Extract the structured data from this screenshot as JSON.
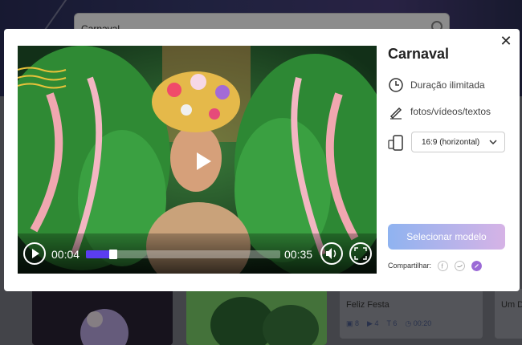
{
  "background": {
    "search_value": "Carnaval",
    "cards": [
      {
        "title": "Feliz Festa",
        "meta": [
          "8",
          "4",
          "6",
          "00:20"
        ]
      },
      {
        "title": "Um D",
        "meta": []
      }
    ]
  },
  "modal": {
    "title": "Carnaval",
    "features": [
      {
        "icon": "clock-icon",
        "label": "Duração ilimitada"
      },
      {
        "icon": "edit-icon",
        "label": "fotos/vídeos/textos"
      }
    ],
    "aspect_select": {
      "selected": "16:9 (horizontal)"
    },
    "cta_label": "Selecionar modelo",
    "share_label": "Compartilhar:",
    "share_icons": [
      "facebook-icon",
      "twitter-icon",
      "link-icon"
    ]
  },
  "video": {
    "current_time": "00:04",
    "duration": "00:35",
    "progress": 0.12
  },
  "colors": {
    "accent": "#5b3df0",
    "cta_start": "#8fb3f0",
    "cta_end": "#d6b3e6"
  }
}
